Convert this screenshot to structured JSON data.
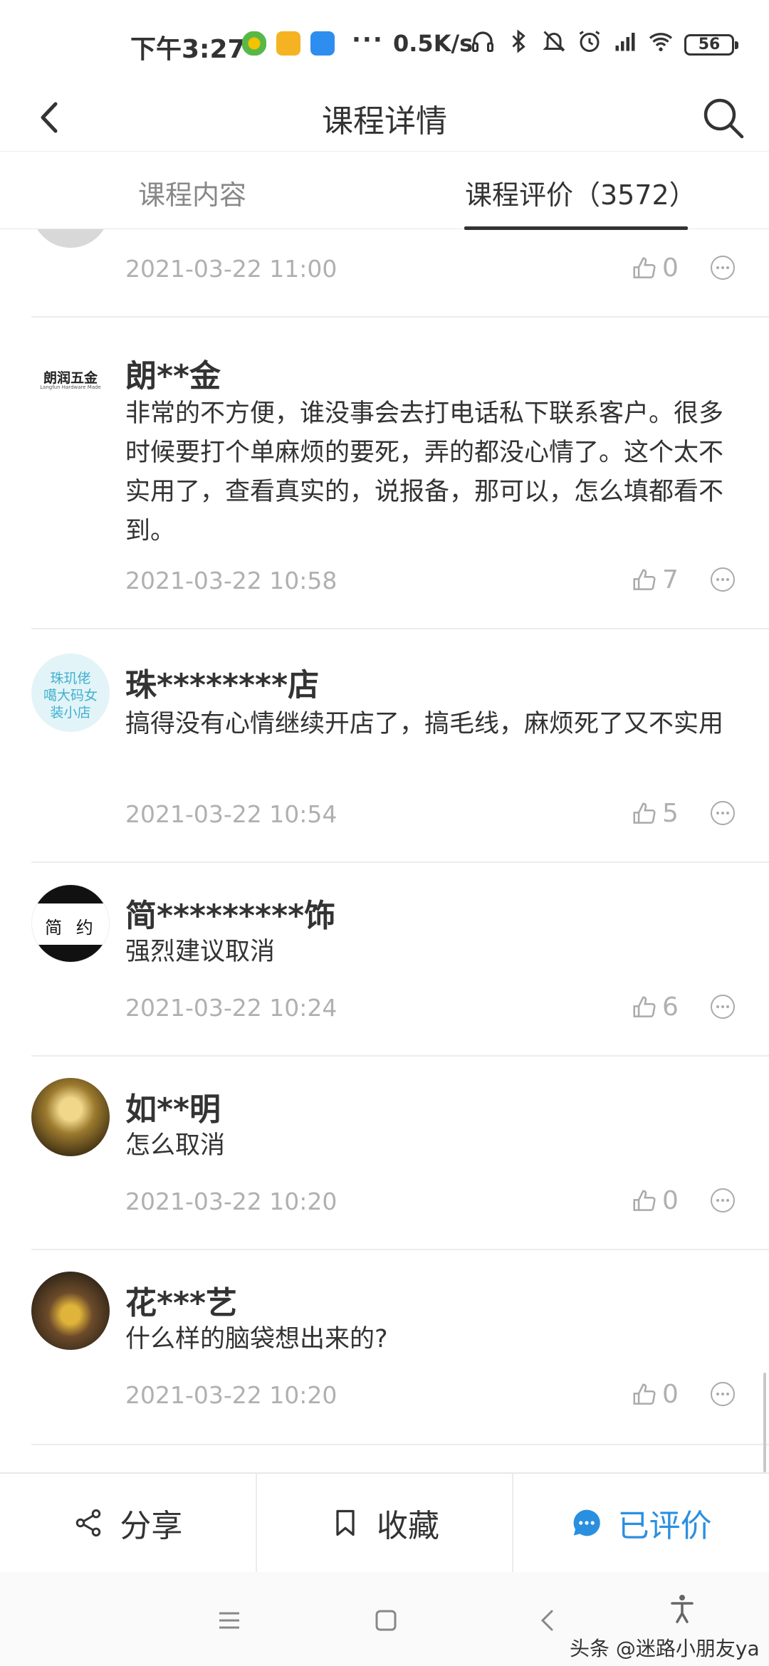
{
  "status_bar": {
    "time": "下午3:27",
    "dots": "···",
    "network_speed": "0.5K/s",
    "battery": "56",
    "icons": [
      "app-green-icon",
      "app-yellow-icon",
      "app-blue-icon",
      "headphones-icon",
      "bluetooth-icon",
      "mute-icon",
      "alarm-icon",
      "signal-hd-icon",
      "wifi-icon"
    ]
  },
  "header": {
    "title": "课程详情",
    "back_icon": "chevron-left-icon",
    "search_icon": "search-icon"
  },
  "tabs": [
    {
      "label": "课程内容",
      "active": false
    },
    {
      "label": "课程评价（3572）",
      "active": true
    }
  ],
  "reviews": [
    {
      "name": "",
      "text": "",
      "date": "2021-03-22 11:00",
      "likes": "0",
      "avatar": "partial"
    },
    {
      "name": "朗**金",
      "text": "非常的不方便，谁没事会去打电话私下联系客户。很多时候要打个单麻烦的要死，弄的都没心情了。这个太不实用了，查看真实的，说报备，那可以，怎么填都看不到。",
      "date": "2021-03-22 10:58",
      "likes": "7",
      "avatar_title": "朗润五金",
      "avatar_sub": "Langfun Hardware Made"
    },
    {
      "name": "珠********店",
      "text": "搞得没有心情继续开店了，搞毛线，麻烦死了又不实用",
      "date": "2021-03-22 10:54",
      "likes": "5",
      "avatar_lines": [
        "珠玑佬",
        "噶大码女",
        "装小店"
      ]
    },
    {
      "name": "简*********饰",
      "text": "强烈建议取消",
      "date": "2021-03-22 10:24",
      "likes": "6",
      "avatar_text": "简 约"
    },
    {
      "name": "如**明",
      "text": "怎么取消",
      "date": "2021-03-22 10:20",
      "likes": "0"
    },
    {
      "name": "花***艺",
      "text": "什么样的脑袋想出来的?",
      "date": "2021-03-22 10:20",
      "likes": "0"
    }
  ],
  "actions": [
    {
      "label": "分享",
      "icon": "share-icon"
    },
    {
      "label": "收藏",
      "icon": "bookmark-icon"
    },
    {
      "label": "已评价",
      "icon": "comment-bubble-icon"
    }
  ],
  "colors": {
    "accent": "#2b8fe0",
    "muted": "#b0b0b0",
    "text": "#333333"
  },
  "watermark": "头条 @迷路小朋友ya"
}
